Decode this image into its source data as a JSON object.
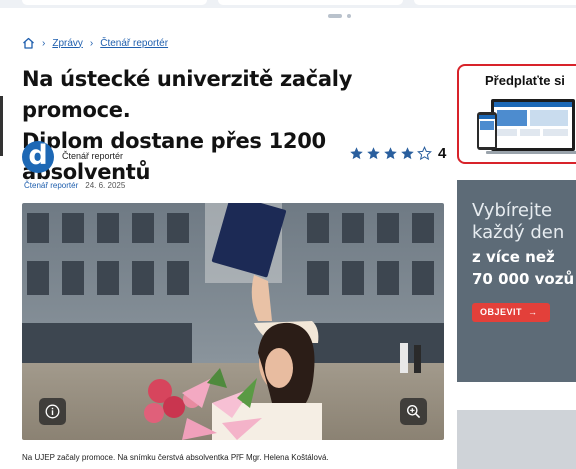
{
  "breadcrumb": {
    "items": [
      "Zprávy",
      "Čtenář reportér"
    ]
  },
  "article": {
    "title_line1": "Na ústecké univerzitě začaly promoce.",
    "title_line2": "Diplom dostane přes 1200 absolventů",
    "author": "Čtenář reportér",
    "author_logo_letter": "d",
    "rating": {
      "stars_filled": 4,
      "stars_total": 5,
      "value": "4"
    },
    "tag": "Čtenář reportér",
    "date": "24. 6. 2025",
    "caption": "Na UJEP začaly promoce. Na snímku čerstvá absolventka PřF Mgr. Helena Koštálová."
  },
  "sidebar": {
    "promo_title": "Předplaťte si",
    "ad": {
      "line1": "Vybírejte",
      "line2": "každý den",
      "line3": "z více než",
      "line4": "70 000 vozů",
      "button": "OBJEVIT"
    }
  },
  "icons": {
    "home": "home-icon",
    "chevron": "chevron-right-icon",
    "info": "info-icon",
    "zoom": "zoom-in-icon",
    "star": "star-icon",
    "arrow": "arrow-right-icon"
  },
  "colors": {
    "link": "#1f5fae",
    "star": "#2a5f9e",
    "logo": "#1d68b5",
    "promo_border": "#d8232a",
    "ad_button": "#e3403a"
  }
}
